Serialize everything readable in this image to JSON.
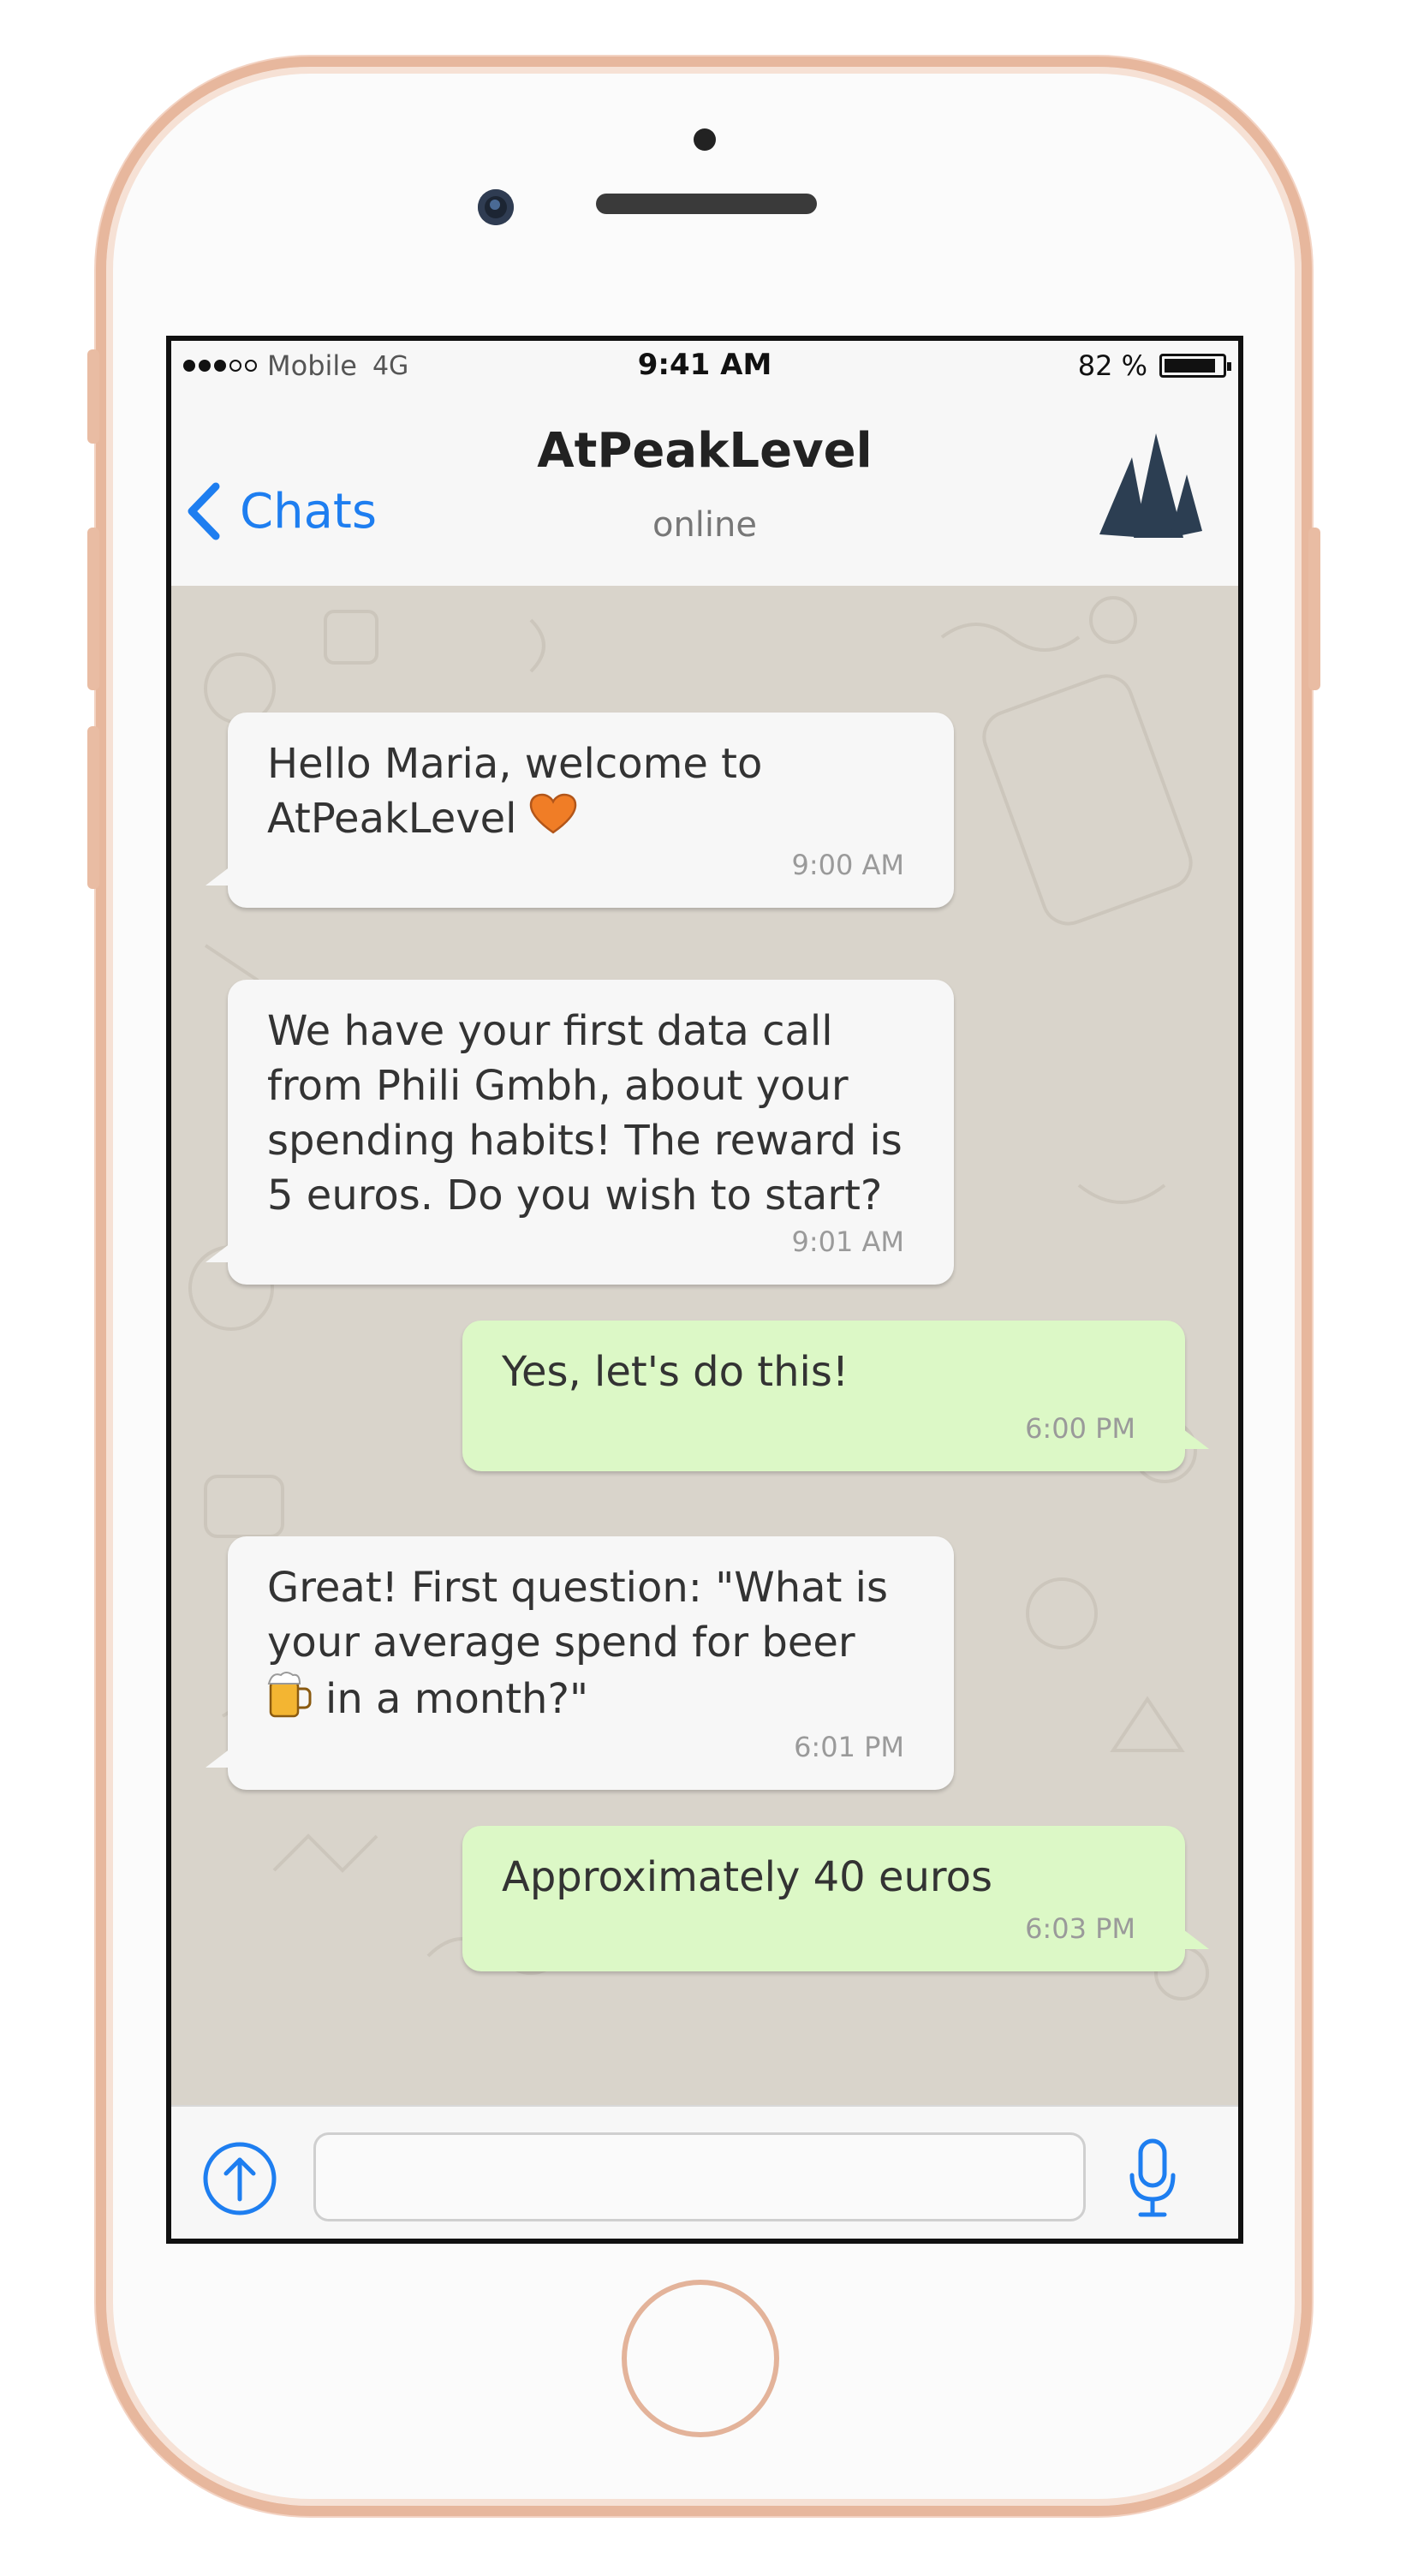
{
  "status_bar": {
    "carrier": "Mobile",
    "network": "4G",
    "time": "9:41 AM",
    "battery": "82 %",
    "battery_level": 0.82
  },
  "header": {
    "back_label": "Chats",
    "title": "AtPeakLevel",
    "subtitle": "online"
  },
  "messages": [
    {
      "direction": "in",
      "lines": [
        "Hello Maria, welcome to",
        "AtPeakLevel"
      ],
      "emoji": "heart-icon",
      "time": "9:00 AM"
    },
    {
      "direction": "in",
      "lines": [
        "We have your first data call",
        "from Phili Gmbh, about your",
        "spending habits! The reward is",
        "5 euros. Do you wish to start?"
      ],
      "time": "9:01 AM"
    },
    {
      "direction": "out",
      "lines": [
        "Yes, let's do this!"
      ],
      "time": "6:00 PM"
    },
    {
      "direction": "in",
      "lines": [
        "Great! First question: \"What is",
        "your average spend for beer",
        "in a month?\""
      ],
      "emoji": "beer-mug-icon",
      "time": "6:01 PM"
    },
    {
      "direction": "out",
      "lines": [
        "Approximately 40 euros"
      ],
      "time": "6:03 PM"
    }
  ],
  "input": {
    "value": "",
    "placeholder": ""
  },
  "colors": {
    "accent": "#1e7ef0",
    "incoming_bubble": "#f7f7f7",
    "outgoing_bubble": "#dcf8c6",
    "chat_background": "#d9d4cb",
    "phone_frame": "#e7b79d",
    "logo": "#2c3e52"
  }
}
